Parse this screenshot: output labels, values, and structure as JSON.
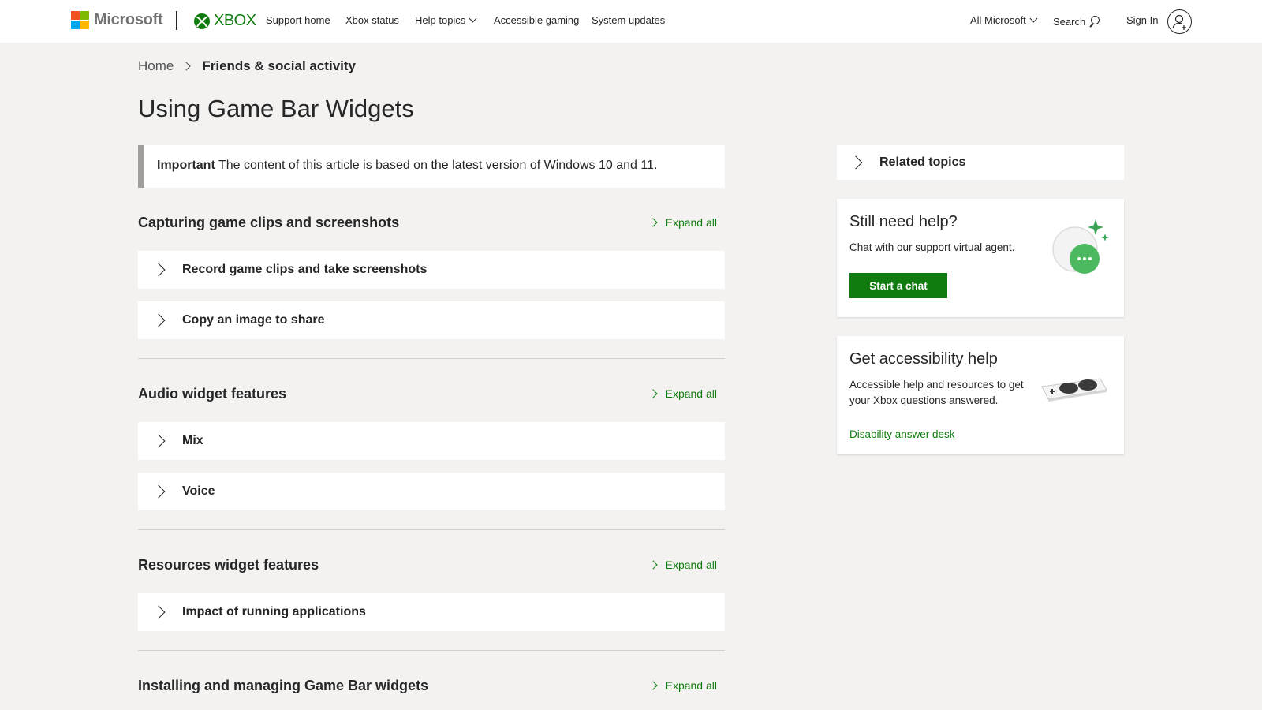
{
  "header": {
    "brand": "Microsoft",
    "product": "XBOX",
    "nav": [
      {
        "label": "Support home"
      },
      {
        "label": "Xbox status"
      },
      {
        "label": "Help topics"
      },
      {
        "label": "Accessible gaming"
      },
      {
        "label": "System updates"
      }
    ],
    "all_microsoft": "All Microsoft",
    "search": "Search",
    "sign_in": "Sign In"
  },
  "breadcrumb": {
    "home": "Home",
    "current": "Friends & social activity"
  },
  "page_title": "Using Game Bar Widgets",
  "notice": {
    "label": "Important",
    "text": "The content of this article is based on the latest version of Windows 10 and 11."
  },
  "sections": [
    {
      "title": "Capturing game clips and screenshots",
      "expand_label": "Expand all",
      "items": [
        "Record game clips and take screenshots",
        "Copy an image to share"
      ]
    },
    {
      "title": "Audio widget features",
      "expand_label": "Expand all",
      "items": [
        "Mix",
        "Voice"
      ]
    },
    {
      "title": "Resources widget features",
      "expand_label": "Expand all",
      "items": [
        "Impact of running applications"
      ]
    },
    {
      "title": "Installing and managing Game Bar widgets",
      "expand_label": "Expand all",
      "items": []
    }
  ],
  "sidebar": {
    "related_topics": "Related topics",
    "help_card": {
      "title": "Still need help?",
      "text": "Chat with our support virtual agent.",
      "button": "Start a chat"
    },
    "accessibility_card": {
      "title": "Get accessibility help",
      "text": "Accessible help and resources to get your Xbox questions answered.",
      "link": "Disability answer desk"
    }
  },
  "colors": {
    "accent": "#107c10",
    "page_bg": "#f3f2f1",
    "text": "#262626"
  }
}
